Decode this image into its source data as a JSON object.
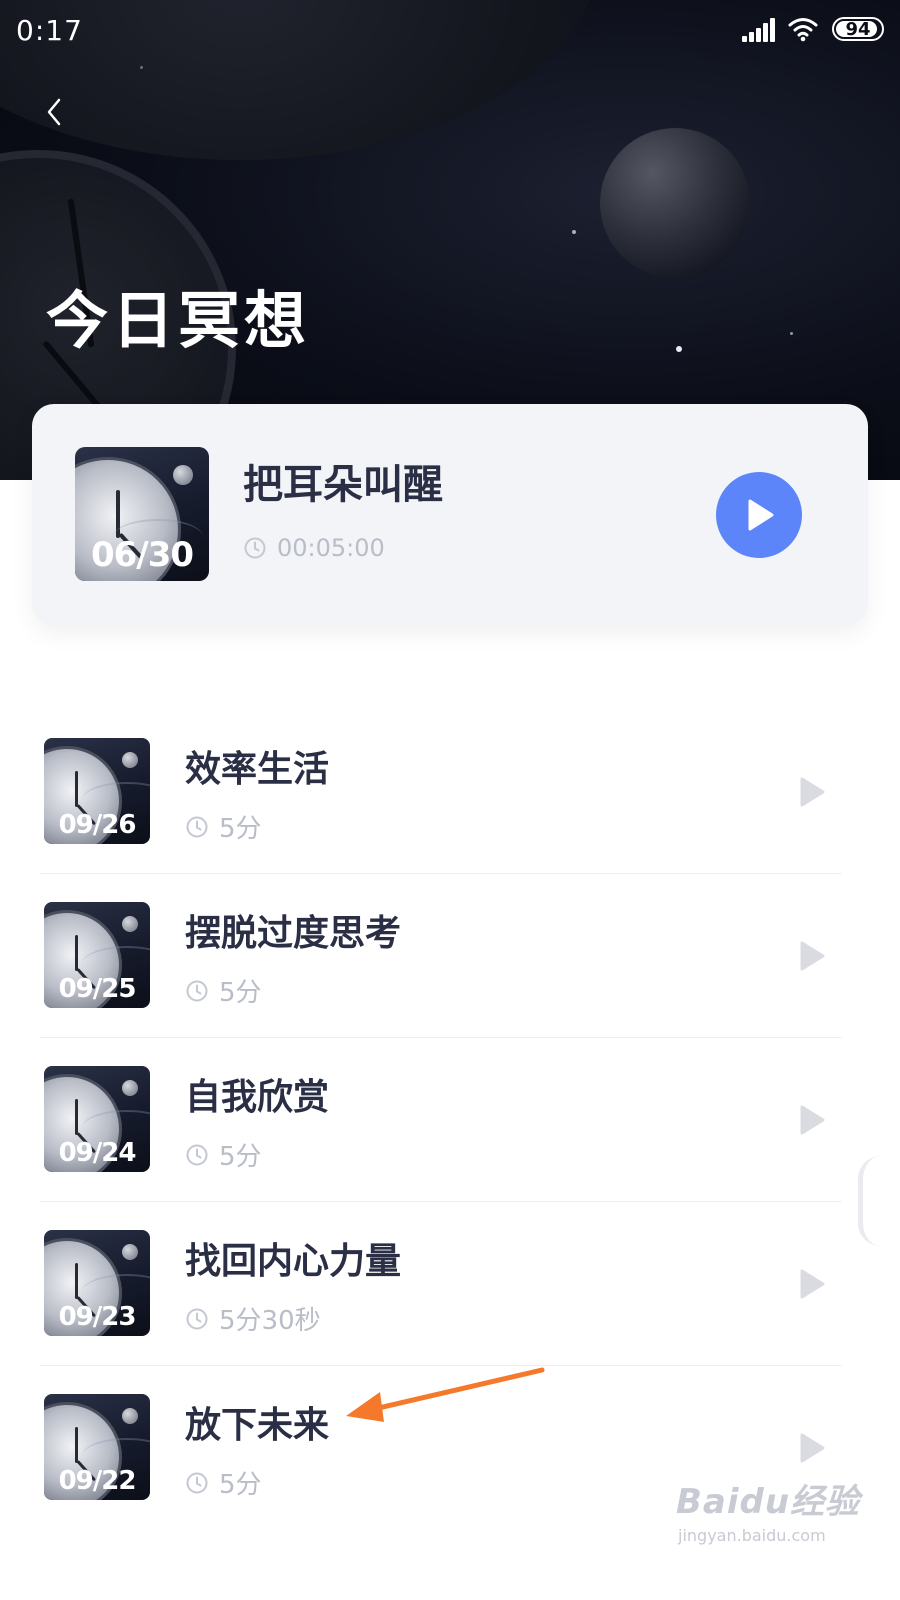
{
  "status_bar": {
    "time": "0:17",
    "battery": "94",
    "battery_level": 0.94
  },
  "header": {
    "title": "今日冥想"
  },
  "featured": {
    "date": "06/30",
    "title": "把耳朵叫醒",
    "duration": "00:05:00",
    "play_color": "#5b85f8"
  },
  "list": [
    {
      "date": "09/26",
      "title": "效率生活",
      "duration": "5分"
    },
    {
      "date": "09/25",
      "title": "摆脱过度思考",
      "duration": "5分"
    },
    {
      "date": "09/24",
      "title": "自我欣赏",
      "duration": "5分"
    },
    {
      "date": "09/23",
      "title": "找回内心力量",
      "duration": "5分30秒"
    },
    {
      "date": "09/22",
      "title": "放下未来",
      "duration": "5分"
    }
  ],
  "watermark": {
    "brand": "Baidu经验",
    "url": "jingyan.baidu.com"
  },
  "colors": {
    "accent": "#5b85f8",
    "annotation": "#f4792b",
    "hero": "#0b0e18"
  },
  "icons": [
    "back-icon",
    "clock-icon",
    "play-icon",
    "signal-icon",
    "wifi-icon",
    "battery-icon"
  ]
}
